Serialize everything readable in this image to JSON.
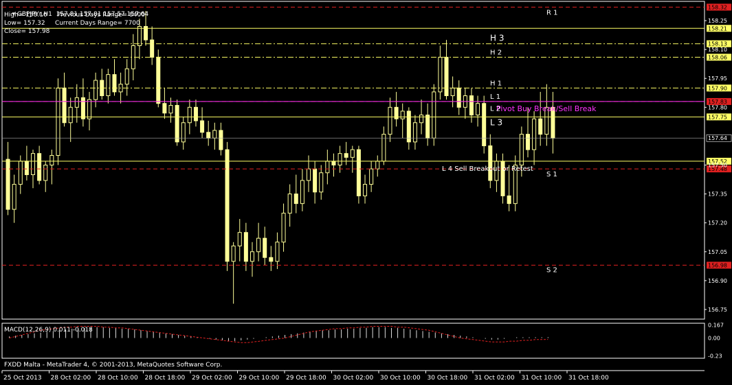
{
  "header": {
    "symbol_line": "GBPJPYr,H1  157.81 157.81 157.57 157.64",
    "high_text": "High= 158.16",
    "prev_range_text": "Previous Days Range= 8400",
    "low_text": "Low= 157.32",
    "curr_range_text": "Current Days Range= 7700",
    "close_text": "Close= 157.98"
  },
  "macd_label": "MACD(12,26,9) 0.011 -0.018",
  "footer": "FXDD Malta - MetaTrader 4, © 2001-2013, MetaQuotes Software Corp.",
  "colors": {
    "background": "#000000",
    "candle": "#ffff99",
    "level_yellow": "#ffff66",
    "level_red": "#e02020",
    "magenta": "#ff33ff",
    "axis": "#ffffff"
  },
  "chart_data": {
    "type": "candlestick",
    "symbol": "GBPJPYr",
    "timeframe": "H1",
    "ylim": [
      156.7,
      158.35
    ],
    "yticks": [
      "158.25",
      "158.10",
      "157.95",
      "157.80",
      "157.64",
      "157.50",
      "157.35",
      "157.20",
      "157.05",
      "156.90",
      "156.75"
    ],
    "ytick_values": [
      158.25,
      158.1,
      157.95,
      157.8,
      157.64,
      157.5,
      157.35,
      157.2,
      157.05,
      156.9,
      156.75
    ],
    "xticks": [
      "25 Oct 2013",
      "28 Oct 02:00",
      "28 Oct 10:00",
      "28 Oct 18:00",
      "29 Oct 02:00",
      "29 Oct 10:00",
      "29 Oct 18:00",
      "30 Oct 02:00",
      "30 Oct 10:00",
      "30 Oct 18:00",
      "31 Oct 02:00",
      "31 Oct 10:00",
      "31 Oct 18:00"
    ],
    "current_price": 157.64,
    "levels": [
      {
        "label": "R 1",
        "value": 158.32,
        "price_label": "158.32",
        "color": "red",
        "style": "dash"
      },
      {
        "label": "",
        "value": 158.21,
        "price_label": "158.21",
        "color": "yellow",
        "style": "solid"
      },
      {
        "label": "H 3",
        "value": 158.13,
        "price_label": "158.13",
        "color": "yellow",
        "style": "dashdot"
      },
      {
        "label": "H 2",
        "value": 158.06,
        "price_label": "158.06",
        "color": "yellow",
        "style": "dashdot"
      },
      {
        "label": "H 1",
        "value": 157.9,
        "price_label": "157.90",
        "color": "yellow",
        "style": "dashdot"
      },
      {
        "label": "L 1",
        "value": 157.83,
        "price_label": "157.83",
        "color": "red",
        "style": "dash"
      },
      {
        "label": "Pivot Buy Break/Sell Break",
        "value": 157.83,
        "price_label": "",
        "color": "magenta",
        "style": "solid"
      },
      {
        "label": "L 2",
        "value": 157.75,
        "price_label": "157.75",
        "color": "yellow",
        "style": "solid"
      },
      {
        "label": "L 3",
        "value": 157.75,
        "price_label": "",
        "color": "yellow",
        "style": "none"
      },
      {
        "label": "",
        "value": 157.52,
        "price_label": "157.52",
        "color": "yellow",
        "style": "solid"
      },
      {
        "label": "L 4 Sell Breakout or Retest",
        "value": 157.48,
        "price_label": "157.48",
        "color": "red",
        "style": "dash"
      },
      {
        "label": "S 1",
        "value": 157.48,
        "price_label": "",
        "color": "red",
        "style": "none"
      },
      {
        "label": "S 2",
        "value": 156.98,
        "price_label": "156.98",
        "color": "red",
        "style": "dash"
      }
    ],
    "candles": [
      [
        157.53,
        157.62,
        157.24,
        157.27
      ],
      [
        157.27,
        157.45,
        157.2,
        157.4
      ],
      [
        157.4,
        157.55,
        157.35,
        157.52
      ],
      [
        157.52,
        157.6,
        157.42,
        157.45
      ],
      [
        157.45,
        157.58,
        157.38,
        157.56
      ],
      [
        157.56,
        157.6,
        157.4,
        157.42
      ],
      [
        157.42,
        157.52,
        157.36,
        157.5
      ],
      [
        157.5,
        157.58,
        157.4,
        157.55
      ],
      [
        157.55,
        157.95,
        157.5,
        157.9
      ],
      [
        157.9,
        157.98,
        157.7,
        157.72
      ],
      [
        157.72,
        157.85,
        157.62,
        157.8
      ],
      [
        157.8,
        157.92,
        157.72,
        157.85
      ],
      [
        157.85,
        157.95,
        157.7,
        157.74
      ],
      [
        157.74,
        157.88,
        157.68,
        157.84
      ],
      [
        157.84,
        157.98,
        157.8,
        157.94
      ],
      [
        157.94,
        158.0,
        157.84,
        157.86
      ],
      [
        157.86,
        158.0,
        157.82,
        157.97
      ],
      [
        157.97,
        158.05,
        157.86,
        157.88
      ],
      [
        157.88,
        157.98,
        157.82,
        157.92
      ],
      [
        157.92,
        158.05,
        157.86,
        158.0
      ],
      [
        158.0,
        158.18,
        157.94,
        158.12
      ],
      [
        158.12,
        158.26,
        158.05,
        158.22
      ],
      [
        158.22,
        158.3,
        158.12,
        158.15
      ],
      [
        158.15,
        158.22,
        158.02,
        158.06
      ],
      [
        158.06,
        158.1,
        157.8,
        157.82
      ],
      [
        157.82,
        157.9,
        157.74,
        157.77
      ],
      [
        157.77,
        157.85,
        157.72,
        157.81
      ],
      [
        157.81,
        157.84,
        157.6,
        157.62
      ],
      [
        157.62,
        157.75,
        157.58,
        157.72
      ],
      [
        157.72,
        157.84,
        157.66,
        157.8
      ],
      [
        157.8,
        157.84,
        157.7,
        157.73
      ],
      [
        157.73,
        157.8,
        157.64,
        157.67
      ],
      [
        157.67,
        157.73,
        157.6,
        157.64
      ],
      [
        157.64,
        157.72,
        157.58,
        157.68
      ],
      [
        157.68,
        157.72,
        157.55,
        157.58
      ],
      [
        157.58,
        157.62,
        156.95,
        157.0
      ],
      [
        157.0,
        157.1,
        156.78,
        157.08
      ],
      [
        157.08,
        157.22,
        157.0,
        157.15
      ],
      [
        157.15,
        157.2,
        156.95,
        157.0
      ],
      [
        157.0,
        157.1,
        156.92,
        157.05
      ],
      [
        157.05,
        157.2,
        157.0,
        157.12
      ],
      [
        157.12,
        157.18,
        156.98,
        157.02
      ],
      [
        157.02,
        157.08,
        156.95,
        157.0
      ],
      [
        157.0,
        157.15,
        156.96,
        157.1
      ],
      [
        157.1,
        157.3,
        157.05,
        157.25
      ],
      [
        157.25,
        157.4,
        157.18,
        157.35
      ],
      [
        157.35,
        157.45,
        157.25,
        157.3
      ],
      [
        157.3,
        157.48,
        157.26,
        157.42
      ],
      [
        157.42,
        157.55,
        157.36,
        157.48
      ],
      [
        157.48,
        157.52,
        157.3,
        157.36
      ],
      [
        157.36,
        157.5,
        157.32,
        157.46
      ],
      [
        157.46,
        157.58,
        157.4,
        157.52
      ],
      [
        157.52,
        157.56,
        157.44,
        157.5
      ],
      [
        157.5,
        157.6,
        157.46,
        157.56
      ],
      [
        157.56,
        157.62,
        157.5,
        157.54
      ],
      [
        157.54,
        157.6,
        157.46,
        157.58
      ],
      [
        157.58,
        157.6,
        157.3,
        157.34
      ],
      [
        157.34,
        157.45,
        157.3,
        157.4
      ],
      [
        157.4,
        157.52,
        157.36,
        157.48
      ],
      [
        157.48,
        157.55,
        157.44,
        157.52
      ],
      [
        157.52,
        157.7,
        157.5,
        157.66
      ],
      [
        157.66,
        157.85,
        157.62,
        157.8
      ],
      [
        157.8,
        157.88,
        157.7,
        157.74
      ],
      [
        157.74,
        157.82,
        157.64,
        157.78
      ],
      [
        157.78,
        157.8,
        157.58,
        157.62
      ],
      [
        157.62,
        157.76,
        157.58,
        157.72
      ],
      [
        157.72,
        157.84,
        157.66,
        157.76
      ],
      [
        157.76,
        157.82,
        157.6,
        157.64
      ],
      [
        157.64,
        157.92,
        157.6,
        157.88
      ],
      [
        157.88,
        158.12,
        157.84,
        158.06
      ],
      [
        158.06,
        158.15,
        157.84,
        157.86
      ],
      [
        157.86,
        157.96,
        157.8,
        157.9
      ],
      [
        157.9,
        157.94,
        157.76,
        157.8
      ],
      [
        157.8,
        157.9,
        157.74,
        157.86
      ],
      [
        157.86,
        157.9,
        157.72,
        157.76
      ],
      [
        157.76,
        157.86,
        157.7,
        157.82
      ],
      [
        157.82,
        157.86,
        157.56,
        157.6
      ],
      [
        157.6,
        157.66,
        157.38,
        157.42
      ],
      [
        157.42,
        157.56,
        157.36,
        157.52
      ],
      [
        157.52,
        157.56,
        157.3,
        157.34
      ],
      [
        157.34,
        157.5,
        157.26,
        157.3
      ],
      [
        157.3,
        157.55,
        157.26,
        157.5
      ],
      [
        157.5,
        157.7,
        157.44,
        157.66
      ],
      [
        157.66,
        157.8,
        157.54,
        157.58
      ],
      [
        157.58,
        157.78,
        157.5,
        157.74
      ],
      [
        157.74,
        157.88,
        157.6,
        157.66
      ],
      [
        157.66,
        157.92,
        157.6,
        157.8
      ],
      [
        157.8,
        157.88,
        157.56,
        157.64
      ]
    ],
    "macd": {
      "label": "MACD(12,26,9) 0.011 -0.018",
      "yticks": [
        "0.167",
        "0.00",
        "-0.23"
      ],
      "ytick_values": [
        0.167,
        0.0,
        -0.23
      ],
      "ylim": [
        -0.26,
        0.19
      ],
      "histogram": [
        0.02,
        0.03,
        0.04,
        0.05,
        0.06,
        0.07,
        0.08,
        0.09,
        0.1,
        0.11,
        0.12,
        0.12,
        0.13,
        0.13,
        0.14,
        0.14,
        0.13,
        0.13,
        0.12,
        0.12,
        0.11,
        0.1,
        0.09,
        0.08,
        0.07,
        0.06,
        0.05,
        0.04,
        0.03,
        0.02,
        0.01,
        0.0,
        -0.01,
        -0.02,
        -0.03,
        -0.04,
        -0.04,
        -0.03,
        -0.02,
        -0.01,
        0.0,
        0.01,
        0.02,
        0.03,
        0.04,
        0.05,
        0.06,
        0.07,
        0.08,
        0.09,
        0.1,
        0.1,
        0.11,
        0.11,
        0.12,
        0.12,
        0.13,
        0.13,
        0.14,
        0.14,
        0.14,
        0.13,
        0.13,
        0.12,
        0.11,
        0.1,
        0.09,
        0.08,
        0.07,
        0.06,
        0.05,
        0.04,
        0.03,
        0.02,
        0.01,
        0.0,
        -0.01,
        -0.02,
        -0.02,
        -0.01,
        0.0,
        0.01,
        0.01,
        0.01,
        0.01,
        0.01,
        0.011
      ],
      "signal": [
        0.0,
        0.02,
        0.04,
        0.06,
        0.08,
        0.1,
        0.11,
        0.12,
        0.13,
        0.14,
        0.14,
        0.15,
        0.15,
        0.15,
        0.15,
        0.14,
        0.14,
        0.13,
        0.13,
        0.12,
        0.11,
        0.1,
        0.09,
        0.08,
        0.07,
        0.06,
        0.05,
        0.04,
        0.03,
        0.02,
        0.01,
        0.0,
        -0.01,
        -0.02,
        -0.03,
        -0.04,
        -0.05,
        -0.06,
        -0.06,
        -0.05,
        -0.04,
        -0.03,
        -0.02,
        -0.01,
        0.0,
        0.02,
        0.04,
        0.06,
        0.08,
        0.09,
        0.1,
        0.11,
        0.12,
        0.12,
        0.13,
        0.13,
        0.14,
        0.14,
        0.15,
        0.15,
        0.15,
        0.15,
        0.14,
        0.14,
        0.13,
        0.12,
        0.11,
        0.1,
        0.08,
        0.06,
        0.04,
        0.02,
        0.0,
        -0.01,
        -0.02,
        -0.03,
        -0.04,
        -0.05,
        -0.05,
        -0.05,
        -0.04,
        -0.04,
        -0.03,
        -0.03,
        -0.02,
        -0.02,
        -0.018
      ]
    }
  }
}
